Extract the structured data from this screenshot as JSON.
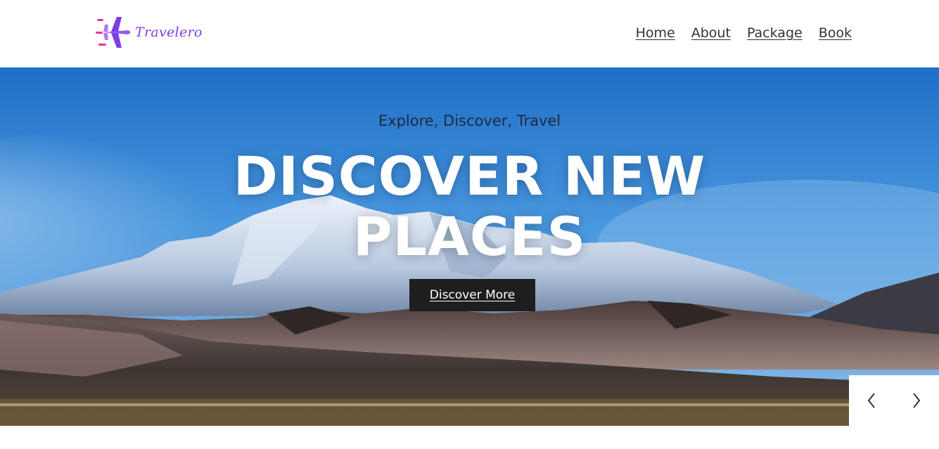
{
  "header": {
    "logo_text": "Travelero",
    "nav": [
      {
        "label": "Home"
      },
      {
        "label": "About"
      },
      {
        "label": "Package"
      },
      {
        "label": "Book"
      }
    ]
  },
  "hero": {
    "subtitle": "Explore, Discover, Travel",
    "title_line1": "DISCOVER NEW",
    "title_line2": "PLACES",
    "button_label": "Discover More"
  },
  "slider": {
    "prev_icon": "chevron-left-icon",
    "next_icon": "chevron-right-icon"
  },
  "colors": {
    "brand": "#7b3fe4",
    "brand_accent": "#e0379a",
    "sky": "#2f86d8",
    "button_bg": "#1e1e1e"
  }
}
